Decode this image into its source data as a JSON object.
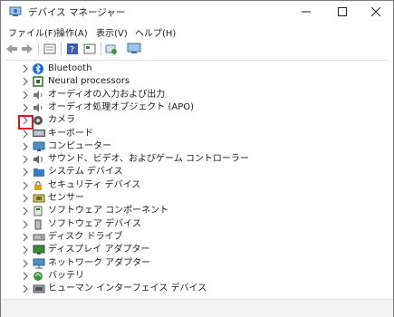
{
  "window": {
    "title": "デバイス マネージャー"
  },
  "menu": [
    "ファイル(F)",
    "操作(A)",
    "表示(V)",
    "ヘルプ(H)"
  ],
  "tree": [
    {
      "label": "Bluetooth",
      "icon": "bluetooth-icon"
    },
    {
      "label": "Neural processors",
      "icon": "processor-icon"
    },
    {
      "label": "オーディオの入力および出力",
      "icon": "speaker-icon"
    },
    {
      "label": "オーディオ処理オブジェクト (APO)",
      "icon": "speaker-icon"
    },
    {
      "label": "カメラ",
      "icon": "camera-icon"
    },
    {
      "label": "キーボード",
      "icon": "keyboard-icon"
    },
    {
      "label": "コンピューター",
      "icon": "computer-icon"
    },
    {
      "label": "サウンド、ビデオ、およびゲーム コントローラー",
      "icon": "sound-icon"
    },
    {
      "label": "システム デバイス",
      "icon": "folder-icon"
    },
    {
      "label": "セキュリティ デバイス",
      "icon": "security-icon"
    },
    {
      "label": "センサー",
      "icon": "sensor-icon"
    },
    {
      "label": "ソフトウェア コンポーネント",
      "icon": "component-icon"
    },
    {
      "label": "ソフトウェア デバイス",
      "icon": "software-device-icon"
    },
    {
      "label": "ディスク ドライブ",
      "icon": "disk-icon"
    },
    {
      "label": "ディスプレイ アダプター",
      "icon": "display-icon"
    },
    {
      "label": "ネットワーク アダプター",
      "icon": "network-icon"
    },
    {
      "label": "バッテリ",
      "icon": "battery-icon"
    },
    {
      "label": "ヒューマン インターフェイス デバイス",
      "icon": "hid-icon"
    }
  ]
}
